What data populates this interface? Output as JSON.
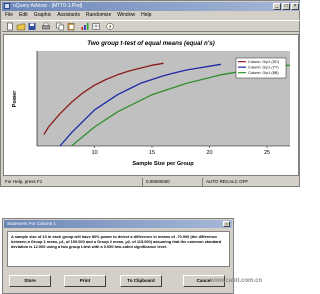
{
  "window": {
    "title": "nQuery Advisor - [MTT0-1.Pnd]",
    "minimize_glyph": "_",
    "maximize_glyph": "□",
    "close_glyph": "×"
  },
  "menu": [
    "File",
    "Edit",
    "Graphic",
    "Assistants",
    "Randomize",
    "Window",
    "Help"
  ],
  "toolbar_icons": [
    "new-file-icon",
    "open-folder-icon",
    "save-icon",
    "print-icon",
    "copy-icon",
    "paste-icon",
    "chart-icon",
    "table-icon",
    "help-icon"
  ],
  "status": {
    "help": "For Help, press F1",
    "value": "0.05000000",
    "mode": "AUTO RECALC OFF"
  },
  "chart_data": {
    "type": "line",
    "title": "Two group t-test of equal means (equal n's)",
    "xlabel": "Sample Size per Group",
    "ylabel": "Power",
    "xlim": [
      5,
      27
    ],
    "ylim": [
      0.5,
      1.0
    ],
    "xticks": [
      10,
      15,
      20,
      25
    ],
    "yticks": [],
    "grid": false,
    "legend_position": "top-right",
    "plot_background": "#c0c0c0",
    "series": [
      {
        "name": "Column: Grp1 (DD)",
        "color": "#8b1a1a",
        "x": [
          5.6,
          6,
          7,
          8,
          9,
          10,
          11,
          12,
          13,
          14,
          15,
          16
        ],
        "y": [
          0.56,
          0.6,
          0.67,
          0.73,
          0.78,
          0.82,
          0.85,
          0.875,
          0.895,
          0.91,
          0.925,
          0.935
        ]
      },
      {
        "name": "Column: Grp1 (YY)",
        "color": "#1c2aa8",
        "x": [
          7,
          8,
          9,
          10,
          11,
          12,
          13,
          14,
          15,
          16,
          17,
          18,
          19,
          20,
          21
        ],
        "y": [
          0.5,
          0.57,
          0.63,
          0.69,
          0.73,
          0.77,
          0.8,
          0.83,
          0.85,
          0.87,
          0.885,
          0.9,
          0.91,
          0.92,
          0.93
        ]
      },
      {
        "name": "Column: Grp1 (BB)",
        "color": "#2f8f2f",
        "x": [
          8,
          9,
          10,
          11,
          12,
          13,
          14,
          15,
          16,
          17,
          18,
          19,
          20,
          21,
          22,
          23,
          24,
          25,
          26,
          27
        ],
        "y": [
          0.5,
          0.55,
          0.6,
          0.64,
          0.68,
          0.71,
          0.74,
          0.77,
          0.79,
          0.81,
          0.83,
          0.845,
          0.86,
          0.875,
          0.885,
          0.895,
          0.905,
          0.915,
          0.92,
          0.925
        ]
      }
    ]
  },
  "dialog": {
    "title": "Statement For Column 1",
    "close_glyph": "×",
    "text": "A sample size of 10 in each group will have 80% power to detect a difference in means of -70.000 (the difference between a Group 1 mean, μ1, of 100.000 and a Group 2 mean, μ2, of 115.000) assuming that the common standard deviation is 12.000 using a two group t-test with a 0.050 two-sided significance level.",
    "buttons": [
      "Store",
      "Print",
      "To Clipboard",
      "Cancel"
    ]
  },
  "watermark": "www.cabit.com.cn"
}
